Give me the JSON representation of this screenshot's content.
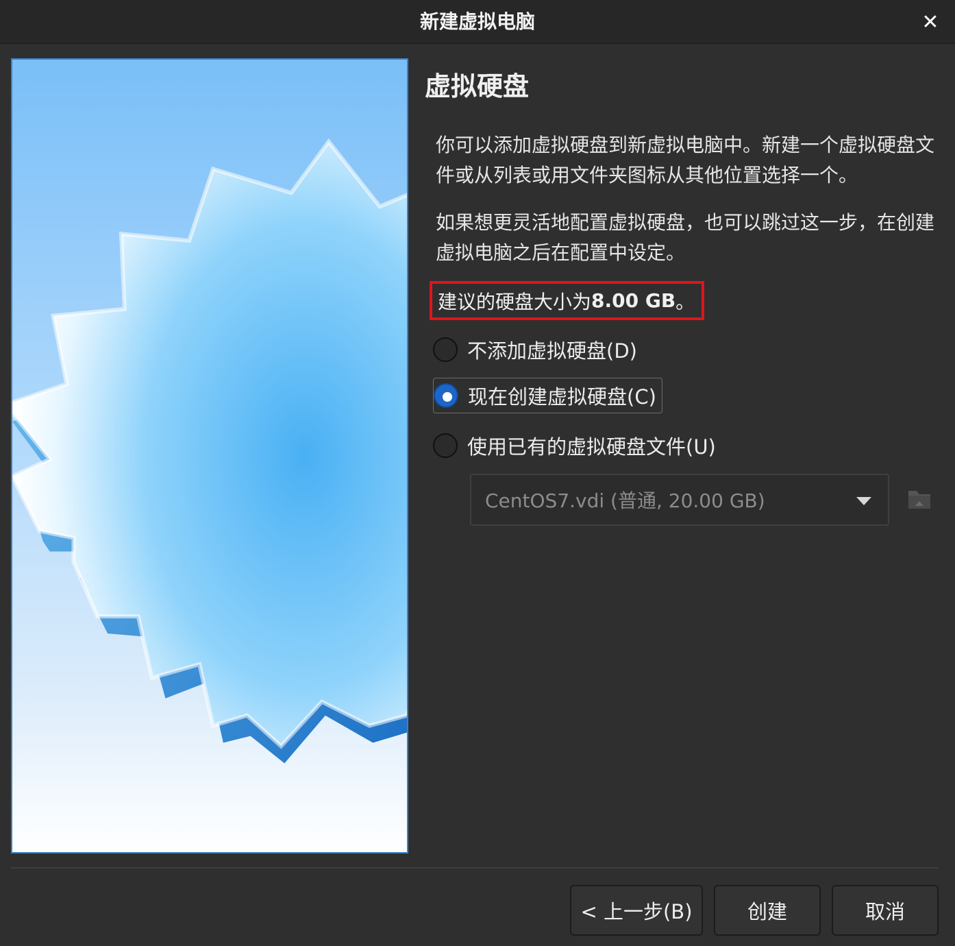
{
  "window": {
    "title": "新建虚拟电脑",
    "close_glyph": "✕"
  },
  "page": {
    "heading": "虚拟硬盘",
    "paragraph1": "你可以添加虚拟硬盘到新虚拟电脑中。新建一个虚拟硬盘文件或从列表或用文件夹图标从其他位置选择一个。",
    "paragraph2": "如果想更灵活地配置虚拟硬盘，也可以跳过这一步，在创建虚拟电脑之后在配置中设定。",
    "recommend_prefix": "建议的硬盘大小为 ",
    "recommend_size": "8.00 GB",
    "recommend_suffix": "。",
    "highlight_color": "#e0141c"
  },
  "options": [
    {
      "label": "不添加虚拟硬盘(D)",
      "checked": false
    },
    {
      "label": "现在创建虚拟硬盘(C)",
      "checked": true
    },
    {
      "label": "使用已有的虚拟硬盘文件(U)",
      "checked": false
    }
  ],
  "disk_select": {
    "value": "CentOS7.vdi (普通, 20.00 GB)",
    "enabled": false,
    "folder_icon": "folder-icon"
  },
  "buttons": {
    "back": "< 上一步(B)",
    "create": "创建",
    "cancel": "取消"
  },
  "colors": {
    "background": "#2f2f2f",
    "radio_checked": "#1e66c6",
    "illustration_blue": "#5bb6f2"
  }
}
